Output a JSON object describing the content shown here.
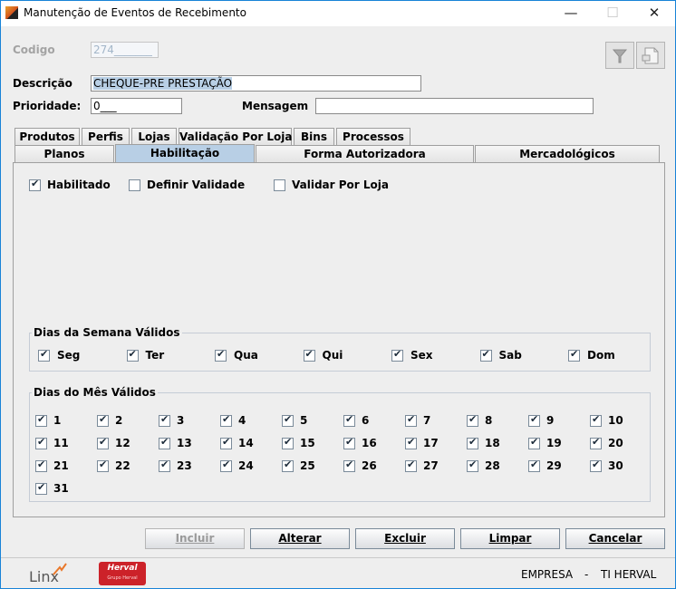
{
  "window": {
    "title": "Manutenção de Eventos de Recebimento",
    "minimize_glyph": "—",
    "maximize_glyph": "☐",
    "close_glyph": "✕"
  },
  "form": {
    "codigo_label": "Codigo",
    "codigo_value": "274_______",
    "descricao_label": "Descrição",
    "descricao_value": "CHEQUE-PRE PRESTAÇÃO",
    "prioridade_label": "Prioridade:",
    "prioridade_value": "0___",
    "mensagem_label": "Mensagem",
    "mensagem_value": ""
  },
  "toolbar": {
    "filter_icon": "funnel-icon",
    "document_icon": "document-icon"
  },
  "tabs_row1": [
    "Produtos",
    "Perfis",
    "Lojas",
    "Validação Por Loja",
    "Bins",
    "Processos"
  ],
  "tabs_row2": [
    "Planos",
    "Habilitação",
    "Forma Autorizadora",
    "Mercadológicos"
  ],
  "active_tab": "Habilitação",
  "habilitacao": {
    "options": [
      {
        "label": "Habilitado",
        "checked": true
      },
      {
        "label": "Definir Validade",
        "checked": false
      },
      {
        "label": "Validar Por Loja",
        "checked": false
      }
    ],
    "dias_semana_title": "Dias da Semana Válidos",
    "dias_semana": [
      {
        "label": "Seg",
        "checked": true
      },
      {
        "label": "Ter",
        "checked": true
      },
      {
        "label": "Qua",
        "checked": true
      },
      {
        "label": "Qui",
        "checked": true
      },
      {
        "label": "Sex",
        "checked": true
      },
      {
        "label": "Sab",
        "checked": true
      },
      {
        "label": "Dom",
        "checked": true
      }
    ],
    "dias_mes_title": "Dias do Mês Válidos",
    "dias_mes": [
      "1",
      "2",
      "3",
      "4",
      "5",
      "6",
      "7",
      "8",
      "9",
      "10",
      "11",
      "12",
      "13",
      "14",
      "15",
      "16",
      "17",
      "18",
      "19",
      "20",
      "21",
      "22",
      "23",
      "24",
      "25",
      "26",
      "27",
      "28",
      "29",
      "30",
      "31"
    ],
    "check_glyph": "✔"
  },
  "buttons": {
    "incluir": "Incluir",
    "alterar": "Alterar",
    "excluir": "Excluir",
    "limpar": "Limpar",
    "cancelar": "Cancelar"
  },
  "footer": {
    "linx_logo": "Linx",
    "herval_logo": "Herval",
    "herval_sub": "Grupo Herval",
    "empresa_label": "EMPRESA",
    "separator": "-",
    "empresa_value": "TI HERVAL"
  },
  "colors": {
    "accent": "#1883d7",
    "active_tab": "#b8cfe5",
    "selection": "#b8cfe5",
    "herval_red": "#cc2229",
    "linx_orange": "#e9782a"
  }
}
